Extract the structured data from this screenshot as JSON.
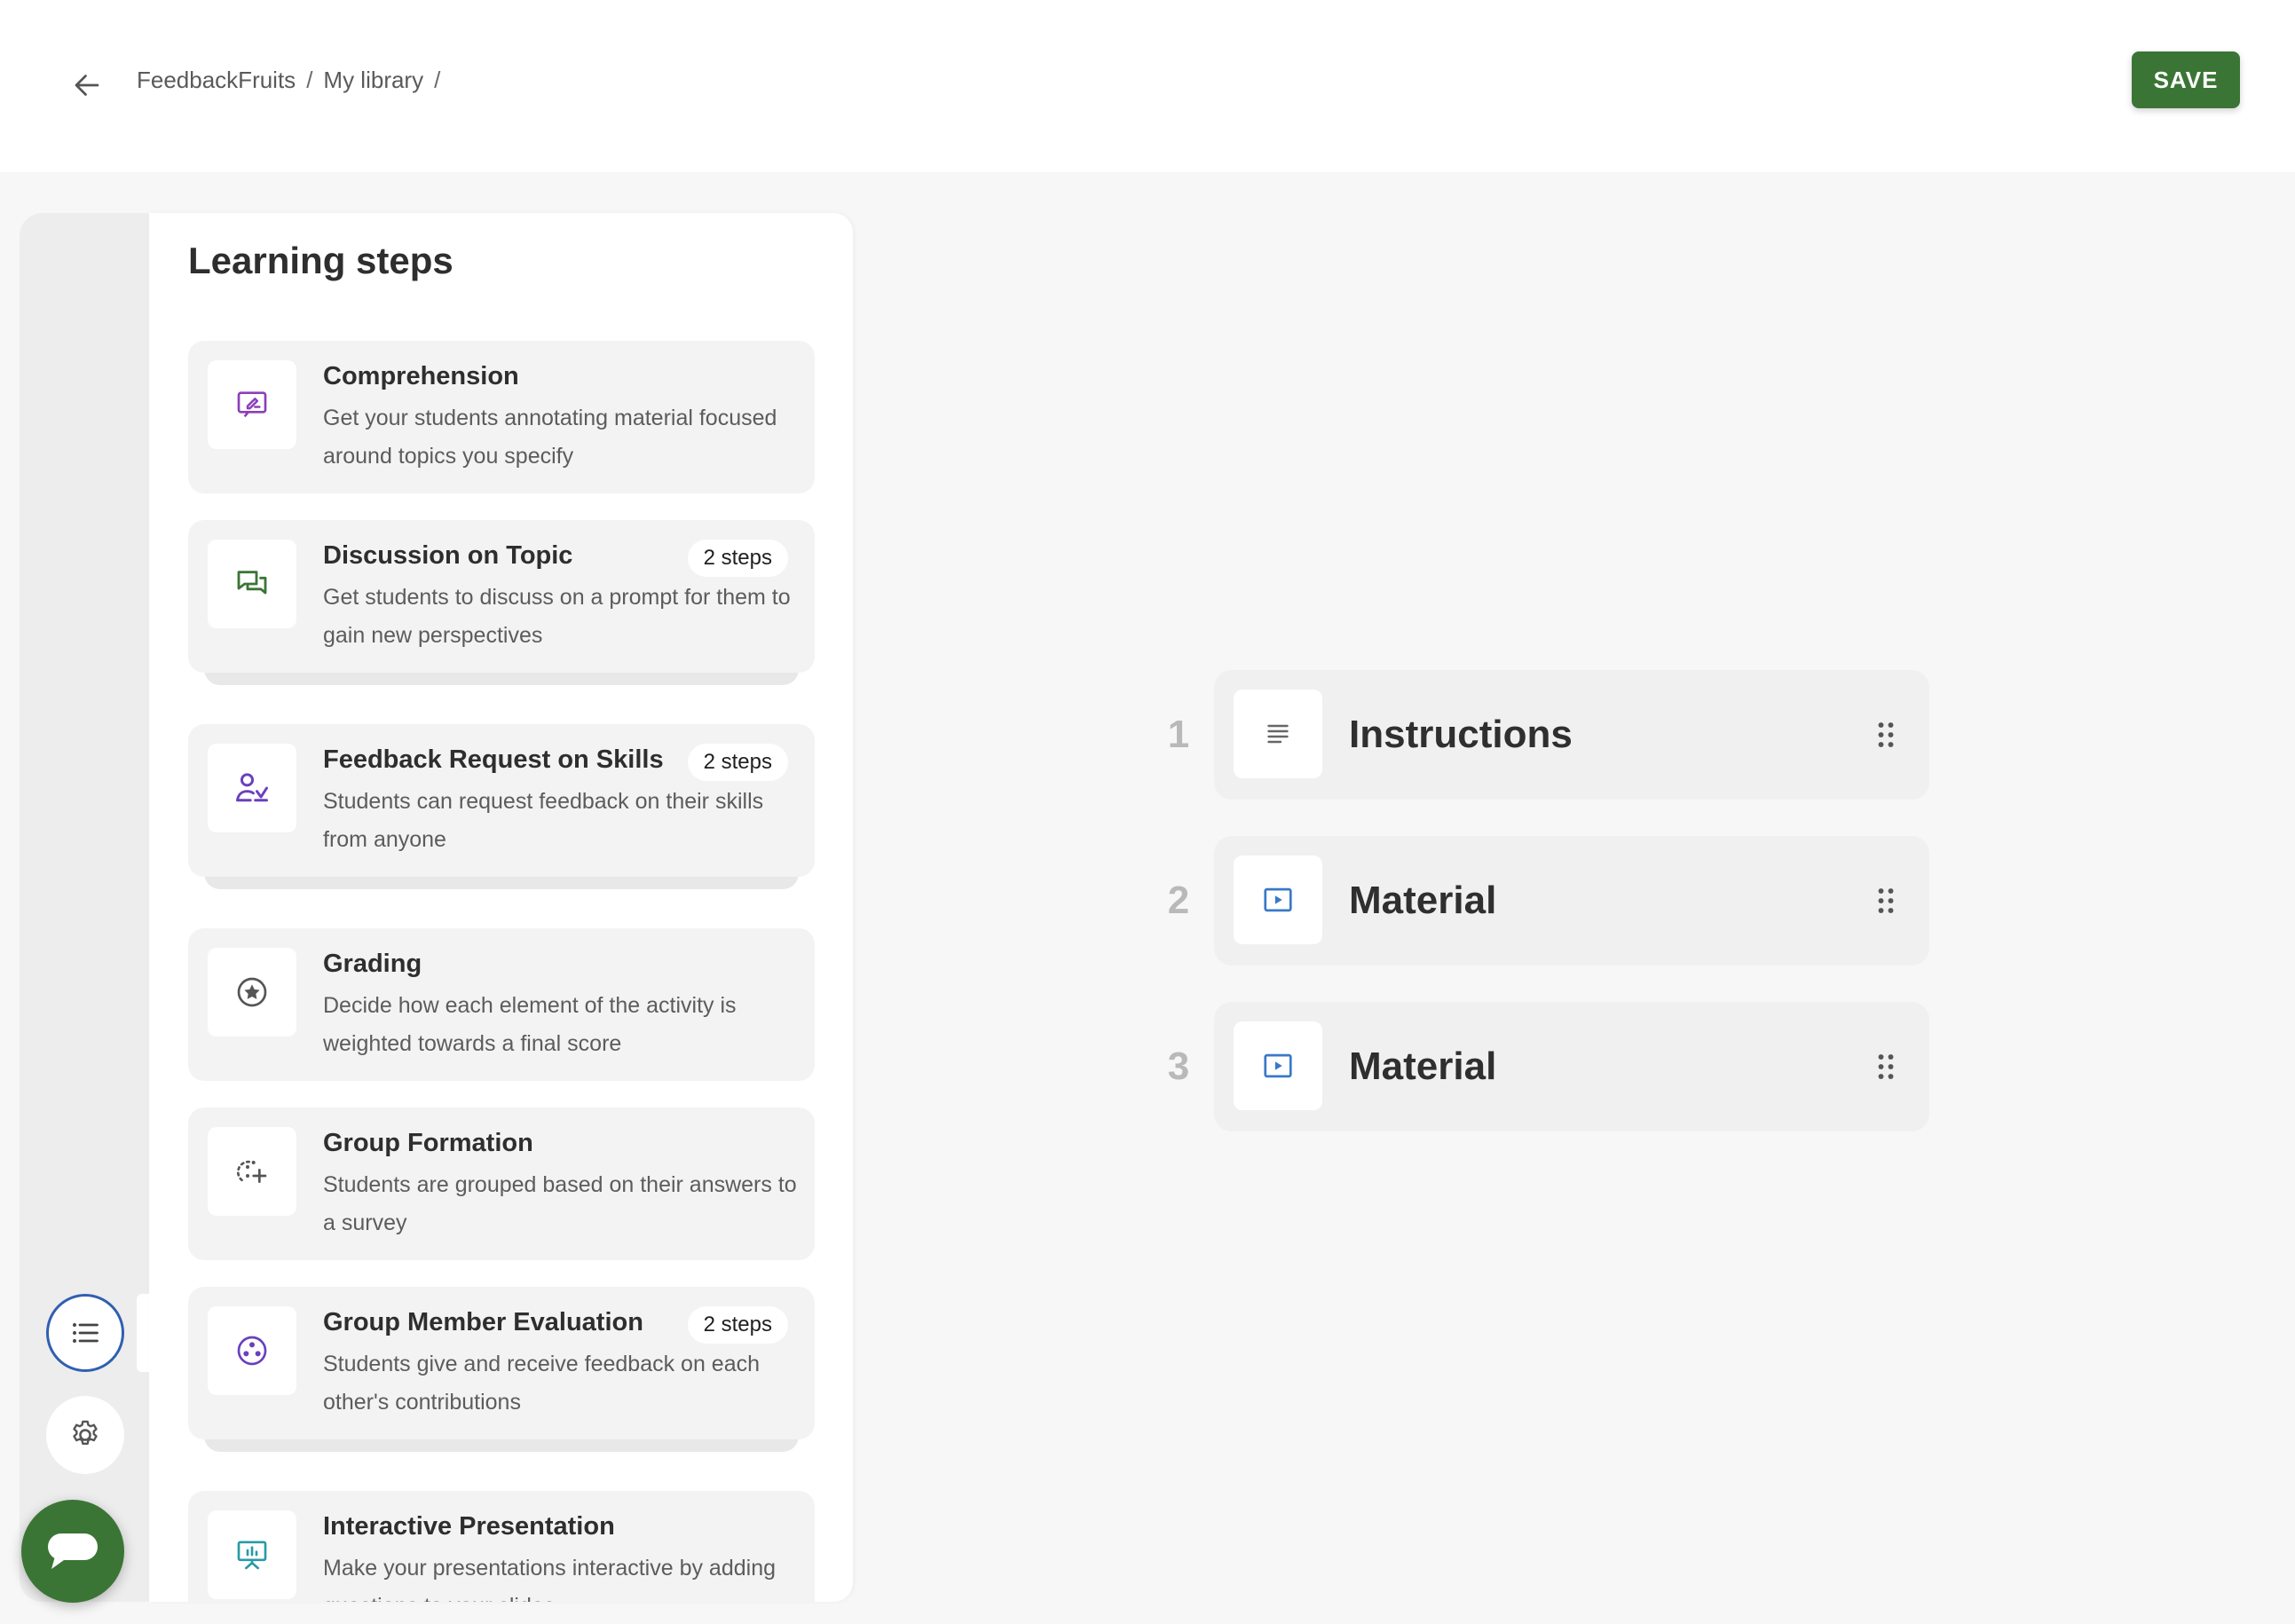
{
  "header": {
    "breadcrumb": [
      {
        "label": "FeedbackFruits"
      },
      {
        "label": "My library"
      }
    ],
    "separator": "/",
    "save_label": "SAVE"
  },
  "panel": {
    "title": "Learning steps",
    "cards": [
      {
        "title": "Comprehension",
        "desc": "Get your students annotating material focused around topics you specify",
        "badge": null,
        "icon": "annotation-icon",
        "color": "#8b3fb8"
      },
      {
        "title": "Discussion on Topic",
        "desc": "Get students to discuss on a prompt for them to gain new perspectives",
        "badge": "2 steps",
        "icon": "chat-bubbles-icon",
        "color": "#3b7535"
      },
      {
        "title": "Feedback Request on Skills",
        "desc": "Students can request feedback on their skills from anyone",
        "badge": "2 steps",
        "icon": "person-check-icon",
        "color": "#6a3fc0"
      },
      {
        "title": "Grading",
        "desc": "Decide how each element of the activity is weighted towards a final score",
        "badge": null,
        "icon": "star-circle-icon",
        "color": "#555555"
      },
      {
        "title": "Group Formation",
        "desc": "Students are grouped based on their answers to a survey",
        "badge": null,
        "icon": "group-add-icon",
        "color": "#555555"
      },
      {
        "title": "Group Member Evaluation",
        "desc": "Students give and receive feedback on each other's contributions",
        "badge": "2 steps",
        "icon": "group-circle-icon",
        "color": "#6a3fc0"
      },
      {
        "title": "Interactive Presentation",
        "desc": "Make your presentations interactive by adding questions to your slides",
        "badge": null,
        "icon": "presentation-icon",
        "color": "#2a9aa6"
      }
    ]
  },
  "steps": [
    {
      "number": "1",
      "label": "Instructions",
      "icon": "text-lines-icon"
    },
    {
      "number": "2",
      "label": "Material",
      "icon": "play-box-icon"
    },
    {
      "number": "3",
      "label": "Material",
      "icon": "play-box-icon"
    }
  ],
  "colors": {
    "brand_green": "#3b7535",
    "active_blue": "#2f5fb0",
    "material_blue": "#3a78c9"
  }
}
